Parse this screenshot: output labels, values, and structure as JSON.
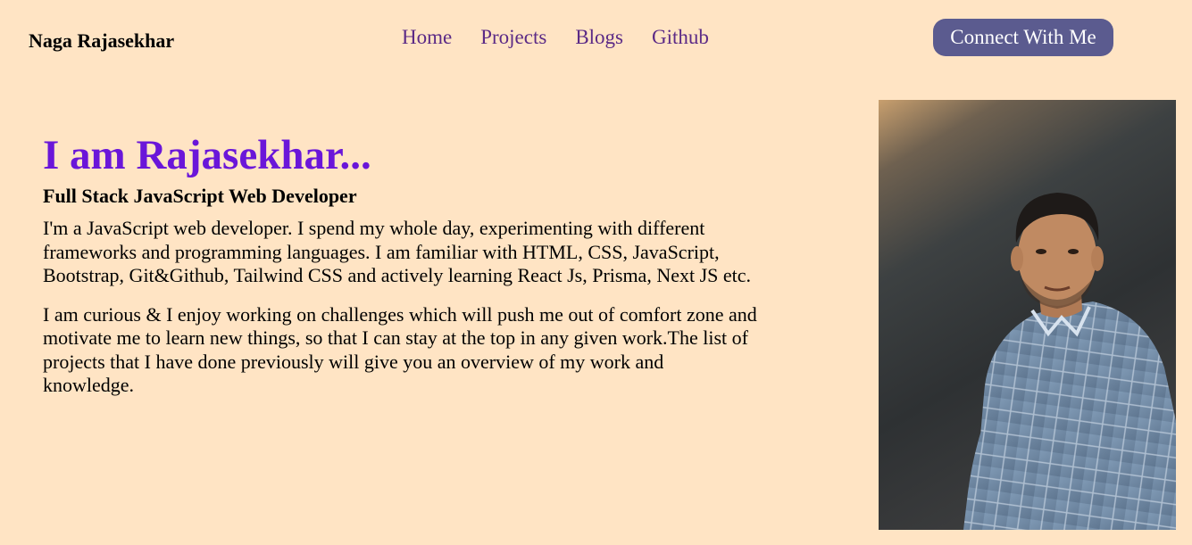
{
  "nav": {
    "brand": "Naga Rajasekhar",
    "links": [
      "Home",
      "Projects",
      "Blogs",
      "Github"
    ],
    "cta_label": "Connect With Me"
  },
  "hero": {
    "title": "I am Rajasekhar...",
    "subtitle": "Full Stack JavaScript Web Developer",
    "paragraph1": "I'm a JavaScript web developer. I spend my whole day, experimenting with different frameworks and programming languages. I am familiar with HTML, CSS, JavaScript, Bootstrap, Git&Github, Tailwind CSS and actively learning React Js, Prisma, Next JS etc.",
    "paragraph2": "I am curious & I enjoy working on challenges which will push me out of comfort zone and motivate me to learn new things, so that I can stay at the top in any given work.The list of projects that I have done previously will give you an overview of my work and knowledge."
  },
  "colors": {
    "background": "#ffe4c4",
    "nav_link": "#5b2a86",
    "cta_bg": "#5b5b8f",
    "title": "#6a16d9"
  }
}
